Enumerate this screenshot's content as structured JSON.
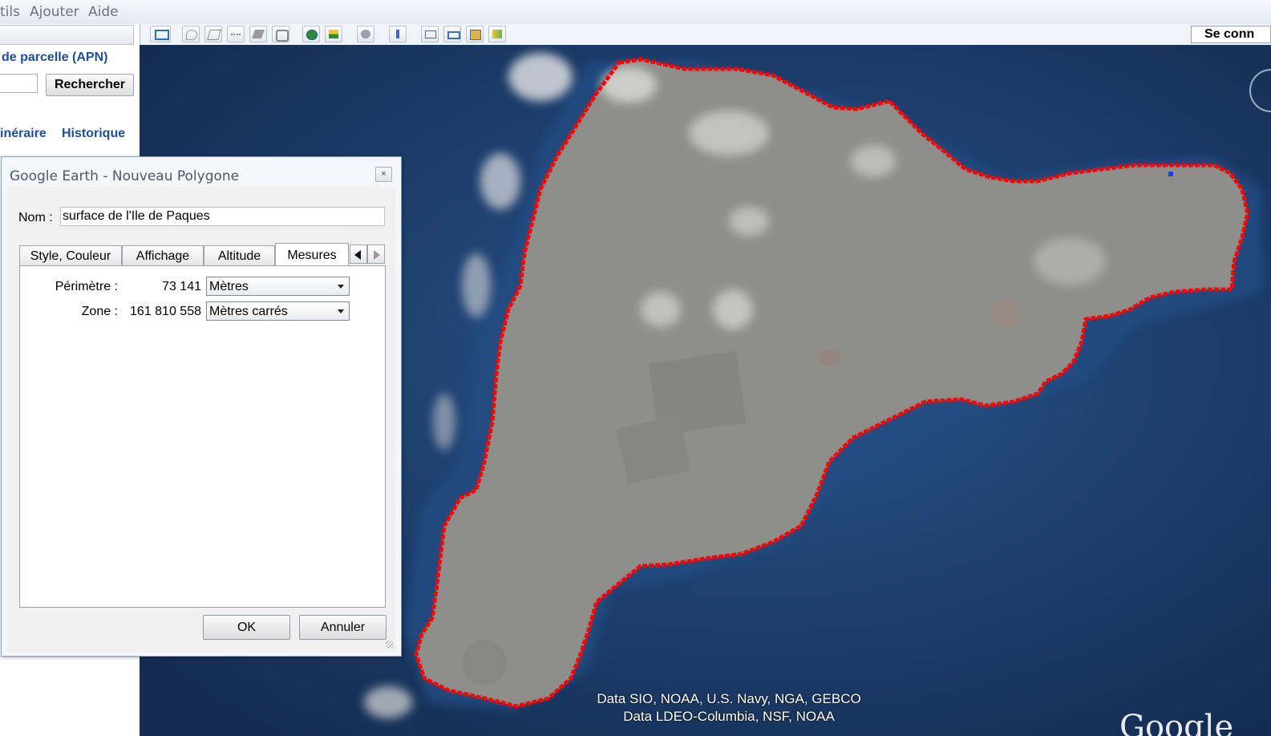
{
  "menu": {
    "items": [
      "tils",
      "Ajouter",
      "Aide"
    ]
  },
  "toolbar": {
    "buttons": [
      "sidebar-toggle-icon",
      "placemark-icon",
      "polygon-icon",
      "path-icon",
      "image-overlay-icon",
      "record-tour-icon",
      "historical-imagery-icon",
      "sunlight-icon",
      "planets-icon",
      "ruler-icon",
      "email-icon",
      "print-icon",
      "save-image-icon",
      "view-in-maps-icon"
    ],
    "signin_label": "Se conn"
  },
  "sidebar": {
    "apn_title": "de parcelle (APN)",
    "search_button": "Rechercher",
    "itinerary_tab": "inéraire",
    "history_tab": "Historique"
  },
  "dialog": {
    "title": "Google Earth - Nouveau Polygone",
    "close_glyph": "×",
    "name_label": "Nom :",
    "name_value": "surface de l'Ile de Paques",
    "tabs": [
      "Style, Couleur",
      "Affichage",
      "Altitude",
      "Mesures"
    ],
    "active_tab": "Mesures",
    "perimeter_label": "Périmètre :",
    "perimeter_value": "73 141",
    "perimeter_unit": "Mètres",
    "area_label": "Zone :",
    "area_value": "161 810 558",
    "area_unit": "Mètres carrés",
    "ok_label": "OK",
    "cancel_label": "Annuler"
  },
  "map": {
    "credits_line1": "Data SIO, NOAA, U.S. Navy, NGA, GEBCO",
    "credits_line2": "Data LDEO-Columbia, NSF, NOAA",
    "logo_text": "Google",
    "polygon_color": "#ff0000",
    "ocean_color": "#1c3a66",
    "land_color": "#8c8c88"
  }
}
